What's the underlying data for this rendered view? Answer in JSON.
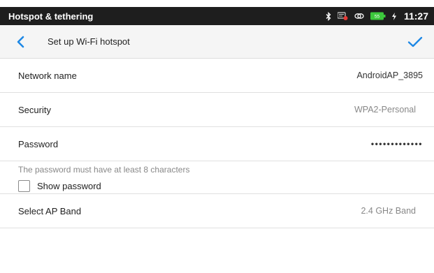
{
  "status_bar": {
    "title": "Hotspot & tethering",
    "time": "11:27",
    "battery_level": "55",
    "icons": [
      "bluetooth-icon",
      "signal-alert-icon",
      "hotspot-icon",
      "battery-icon",
      "charging-icon"
    ],
    "colors": {
      "background": "#1e1e1e",
      "battery": "#3cc83c",
      "alert": "#e53935"
    }
  },
  "toolbar": {
    "title": "Set up Wi-Fi hotspot",
    "accent_color": "#1e88e5"
  },
  "settings": {
    "network_name": {
      "label": "Network name",
      "value": "AndroidAP_3895"
    },
    "security": {
      "label": "Security",
      "value": "WPA2-Personal"
    },
    "password": {
      "label": "Password",
      "value": "•••••••••••••",
      "hint": "The password must have at least 8 characters",
      "show_password_label": "Show password",
      "show_password_checked": false
    },
    "ap_band": {
      "label": "Select AP Band",
      "value": "2.4 GHz Band"
    }
  }
}
